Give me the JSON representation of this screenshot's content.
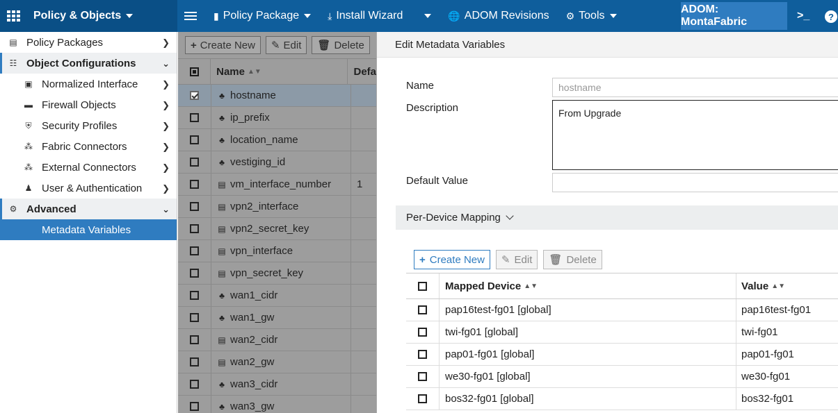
{
  "topbar": {
    "brand": "Policy & Objects",
    "menu": [
      {
        "label": "Policy Package",
        "icon": "policy-package-icon",
        "has_caret": true
      },
      {
        "label": "Install Wizard",
        "icon": "install-icon",
        "has_caret": false
      },
      {
        "label": "",
        "icon": "caret-icon",
        "has_caret": true
      },
      {
        "label": "ADOM Revisions",
        "icon": "globe-icon",
        "has_caret": false
      },
      {
        "label": "Tools",
        "icon": "gear-icon",
        "has_caret": true
      }
    ],
    "adom": "ADOM: MontaFabric",
    "terminal": ">_",
    "help": "?"
  },
  "sidebar": {
    "items": [
      {
        "label": "Policy Packages",
        "icon": "document-icon",
        "chevron": ">",
        "level": 0
      },
      {
        "label": "Object Configurations",
        "icon": "objects-icon",
        "chevron": "v",
        "level": 0
      },
      {
        "label": "Normalized Interface",
        "icon": "interface-icon",
        "chevron": ">",
        "level": 1
      },
      {
        "label": "Firewall Objects",
        "icon": "firewall-icon",
        "chevron": ">",
        "level": 1
      },
      {
        "label": "Security Profiles",
        "icon": "shield-icon",
        "chevron": ">",
        "level": 1
      },
      {
        "label": "Fabric Connectors",
        "icon": "connector-icon",
        "chevron": ">",
        "level": 1
      },
      {
        "label": "External Connectors",
        "icon": "connector-icon",
        "chevron": ">",
        "level": 1
      },
      {
        "label": "User & Authentication",
        "icon": "user-icon",
        "chevron": ">",
        "level": 1
      },
      {
        "label": "Advanced",
        "icon": "advanced-icon",
        "chevron": "v",
        "level": 0
      },
      {
        "label": "Metadata Variables",
        "icon": "",
        "chevron": "",
        "level": 2
      }
    ]
  },
  "list": {
    "toolbar": {
      "create": "Create New",
      "edit": "Edit",
      "delete": "Delete"
    },
    "columns": {
      "name": "Name",
      "default": "Defa"
    },
    "rows": [
      {
        "name": "hostname",
        "default": "",
        "icon": "variable-icon",
        "selected": true
      },
      {
        "name": "ip_prefix",
        "default": "",
        "icon": "variable-icon",
        "selected": false
      },
      {
        "name": "location_name",
        "default": "",
        "icon": "variable-icon",
        "selected": false
      },
      {
        "name": "vestiging_id",
        "default": "",
        "icon": "variable-icon",
        "selected": false
      },
      {
        "name": "vm_interface_number",
        "default": "1",
        "icon": "list-icon",
        "selected": false
      },
      {
        "name": "vpn2_interface",
        "default": "",
        "icon": "list-icon",
        "selected": false
      },
      {
        "name": "vpn2_secret_key",
        "default": "",
        "icon": "list-icon",
        "selected": false
      },
      {
        "name": "vpn_interface",
        "default": "",
        "icon": "list-icon",
        "selected": false
      },
      {
        "name": "vpn_secret_key",
        "default": "",
        "icon": "list-icon",
        "selected": false
      },
      {
        "name": "wan1_cidr",
        "default": "",
        "icon": "variable-icon",
        "selected": false
      },
      {
        "name": "wan1_gw",
        "default": "",
        "icon": "variable-icon",
        "selected": false
      },
      {
        "name": "wan2_cidr",
        "default": "",
        "icon": "list-icon",
        "selected": false
      },
      {
        "name": "wan2_gw",
        "default": "",
        "icon": "list-icon",
        "selected": false
      },
      {
        "name": "wan3_cidr",
        "default": "",
        "icon": "variable-icon",
        "selected": false
      },
      {
        "name": "wan3_gw",
        "default": "",
        "icon": "variable-icon",
        "selected": false
      }
    ]
  },
  "edit": {
    "title": "Edit Metadata Variables",
    "name_label": "Name",
    "name_value": "hostname",
    "description_label": "Description",
    "description_value": "From Upgrade",
    "default_label": "Default Value",
    "default_value": "",
    "mapping_title": "Per-Device Mapping",
    "mapping_toolbar": {
      "create": "Create New",
      "edit": "Edit",
      "delete": "Delete"
    },
    "mapping_columns": {
      "device": "Mapped Device",
      "value": "Value"
    },
    "mappings": [
      {
        "device": "pap16test-fg01 [global]",
        "value": "pap16test-fg01"
      },
      {
        "device": "twi-fg01 [global]",
        "value": "twi-fg01"
      },
      {
        "device": "pap01-fg01 [global]",
        "value": "pap01-fg01"
      },
      {
        "device": "we30-fg01 [global]",
        "value": "we30-fg01"
      },
      {
        "device": "bos32-fg01 [global]",
        "value": "bos32-fg01"
      }
    ]
  },
  "colors": {
    "topbar": "#0f5e9c",
    "accent": "#2f7cc0",
    "overlay": "#9d9d9d"
  }
}
